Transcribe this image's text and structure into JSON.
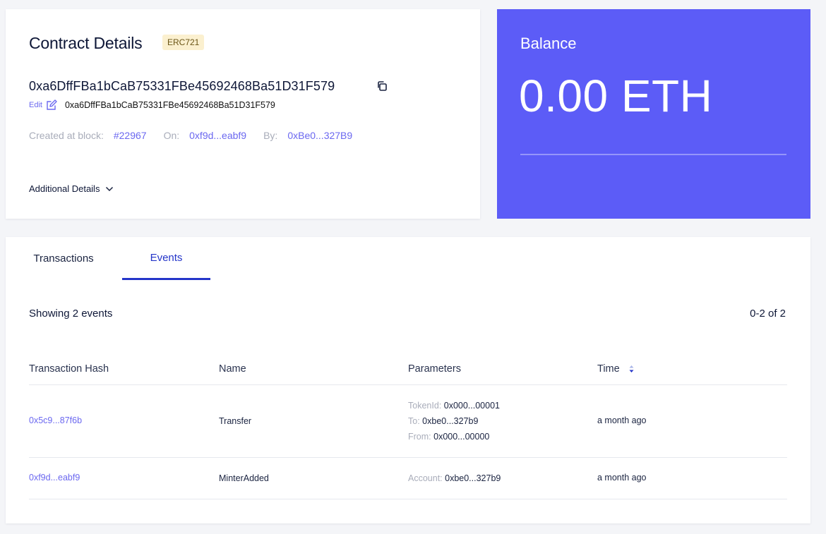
{
  "contract": {
    "title": "Contract Details",
    "badge": "ERC721",
    "address": "0xa6DffFBa1bCaB75331FBe45692468Ba51D31F579",
    "edit_label": "Edit",
    "address_sub": "0xa6DffFBa1bCaB75331FBe45692468Ba51D31F579",
    "created_label": "Created at block:",
    "created_block": "#22967",
    "on_label": "On:",
    "on_value": "0xf9d...eabf9",
    "by_label": "By:",
    "by_value": "0xBe0...327B9",
    "additional_details": "Additional Details"
  },
  "balance": {
    "label": "Balance",
    "value": "0.00 ETH"
  },
  "tabs": [
    {
      "label": "Transactions",
      "active": false
    },
    {
      "label": "Events",
      "active": true
    }
  ],
  "events": {
    "showing": "Showing 2 events",
    "pagination": "0-2 of 2",
    "columns": [
      "Transaction Hash",
      "Name",
      "Parameters",
      "Time"
    ],
    "rows": [
      {
        "hash": "0x5c9...87f6b",
        "name": "Transfer",
        "params": [
          {
            "key": "TokenId:",
            "value": "0x000...00001"
          },
          {
            "key": "To:",
            "value": "0xbe0...327b9"
          },
          {
            "key": "From:",
            "value": "0x000...00000"
          }
        ],
        "time": "a month ago"
      },
      {
        "hash": "0xf9d...eabf9",
        "name": "MinterAdded",
        "params": [
          {
            "key": "Account:",
            "value": "0xbe0...327b9"
          }
        ],
        "time": "a month ago"
      }
    ]
  },
  "colors": {
    "accent": "#5c5cf7",
    "link": "#6b68f0",
    "active_tab": "#2435c9",
    "badge_bg": "#fbf0cf"
  },
  "icons": {
    "copy": "copy-icon",
    "edit": "edit-icon",
    "chevron": "chevron-down-icon",
    "sort": "sort-icon"
  }
}
